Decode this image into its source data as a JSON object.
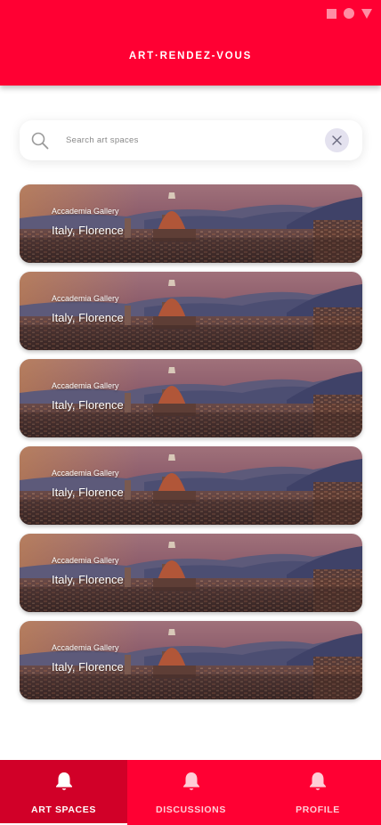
{
  "header": {
    "title": "ART·RENDEZ-VOUS",
    "background": "#ff0033"
  },
  "status_icons": [
    "square-icon",
    "circle-icon",
    "triangle-icon"
  ],
  "search": {
    "placeholder": "Search art spaces",
    "value": "",
    "clear_icon": "close-icon"
  },
  "cards": [
    {
      "subtitle": "Accademia Gallery",
      "title": "Italy, Florence"
    },
    {
      "subtitle": "Accademia Gallery",
      "title": "Italy, Florence"
    },
    {
      "subtitle": "Accademia Gallery",
      "title": "Italy, Florence"
    },
    {
      "subtitle": "Accademia Gallery",
      "title": "Italy, Florence"
    },
    {
      "subtitle": "Accademia Gallery",
      "title": "Italy, Florence"
    },
    {
      "subtitle": "Accademia Gallery",
      "title": "Italy, Florence"
    }
  ],
  "nav": {
    "items": [
      {
        "label": "ART SPACES",
        "icon": "bell-icon",
        "active": true
      },
      {
        "label": "DISCUSSIONS",
        "icon": "bell-icon",
        "active": false
      },
      {
        "label": "PROFILE",
        "icon": "bell-icon",
        "active": false
      }
    ],
    "active_color": "#d10028"
  }
}
